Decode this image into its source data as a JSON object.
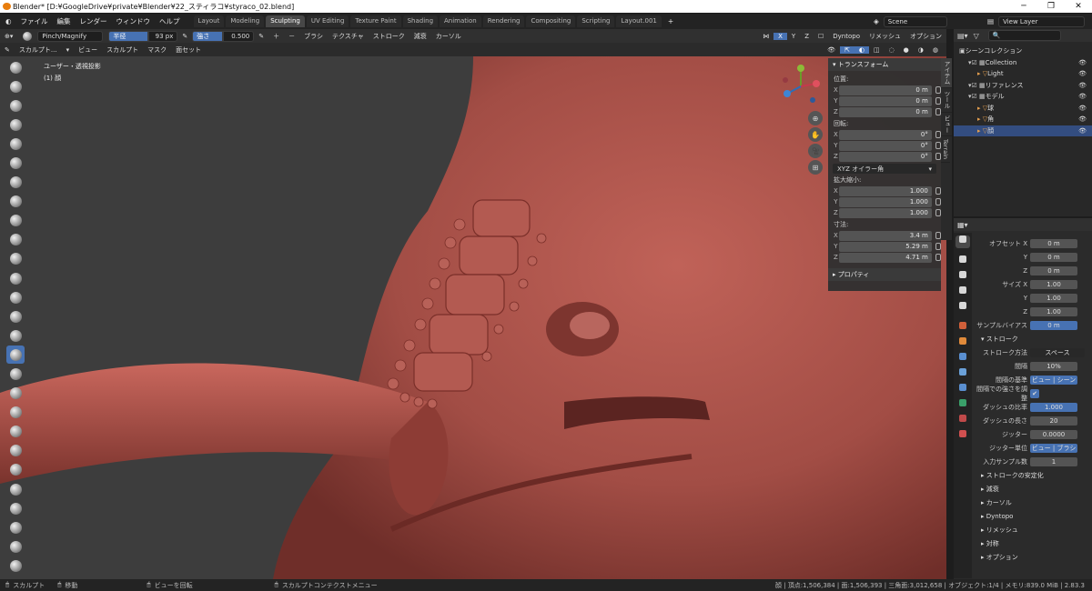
{
  "title": "Blender* [D:¥GoogleDrive¥private¥Blender¥22_スティラコ¥styraco_02.blend]",
  "menus": [
    "ファイル",
    "編集",
    "レンダー",
    "ウィンドウ",
    "ヘルプ"
  ],
  "workspaces": [
    "Layout",
    "Modeling",
    "Sculpting",
    "UV Editing",
    "Texture Paint",
    "Shading",
    "Animation",
    "Rendering",
    "Compositing",
    "Scripting",
    "Layout.001"
  ],
  "scene": "Scene",
  "view_layer": "View Layer",
  "hdr1": {
    "brush": "Pinch/Magnify",
    "radius_label": "半径",
    "radius_val": "93 px",
    "strength_label": "強さ",
    "strength_val": "0.500",
    "brush_menu": "ブラシ",
    "tex_menu": "テクスチャ",
    "stroke_menu": "ストローク",
    "falloff_menu": "減衰",
    "cursor_menu": "カーソル",
    "axes": [
      "X",
      "Y",
      "Z"
    ],
    "dyntopo": "Dyntopo",
    "remesh": "リメッシュ",
    "options": "オプション"
  },
  "hdr2": {
    "mode": "スカルプト...",
    "items": [
      "ビュー",
      "スカルプト",
      "マスク",
      "面セット"
    ]
  },
  "viewport": {
    "view_name": "ユーザー・透視投影",
    "object": "(1) 顔"
  },
  "npanel": {
    "transform_title": "トランスフォーム",
    "loc_label": "位置:",
    "loc": [
      [
        "X",
        "0 m"
      ],
      [
        "Y",
        "0 m"
      ],
      [
        "Z",
        "0 m"
      ]
    ],
    "rot_label": "回転:",
    "rot": [
      [
        "X",
        "0°"
      ],
      [
        "Y",
        "0°"
      ],
      [
        "Z",
        "0°"
      ]
    ],
    "rot_mode": "XYZ オイラー角",
    "scale_label": "拡大縮小:",
    "scale": [
      [
        "X",
        "1.000"
      ],
      [
        "Y",
        "1.000"
      ],
      [
        "Z",
        "1.000"
      ]
    ],
    "dim_label": "寸法:",
    "dim": [
      [
        "X",
        "3.4 m"
      ],
      [
        "Y",
        "5.29 m"
      ],
      [
        "Z",
        "4.71 m"
      ]
    ],
    "props_title": "プロパティ"
  },
  "vtabs": [
    "アイテム",
    "ツール",
    "ビュー",
    "Terrain"
  ],
  "outliner": [
    {
      "label": "シーンコレクション",
      "indent": 0,
      "sel": false
    },
    {
      "label": "Collection",
      "indent": 1,
      "sel": false
    },
    {
      "label": "Light",
      "indent": 2,
      "sel": false
    },
    {
      "label": "リファレンス",
      "indent": 1,
      "sel": false
    },
    {
      "label": "モデル",
      "indent": 1,
      "sel": false
    },
    {
      "label": "球",
      "indent": 2,
      "sel": false
    },
    {
      "label": "角",
      "indent": 2,
      "sel": false
    },
    {
      "label": "顔",
      "indent": 2,
      "sel": true
    }
  ],
  "props": [
    {
      "label": "オフセット X",
      "val": "0 m",
      "type": "val"
    },
    {
      "label": "Y",
      "val": "0 m",
      "type": "val"
    },
    {
      "label": "Z",
      "val": "0 m",
      "type": "val"
    },
    {
      "label": "サイズ X",
      "val": "1.00",
      "type": "val"
    },
    {
      "label": "Y",
      "val": "1.00",
      "type": "val"
    },
    {
      "label": "Z",
      "val": "1.00",
      "type": "val"
    },
    {
      "label": "サンプルバイアス",
      "val": "0 m",
      "type": "blue"
    },
    {
      "label": "▾ ストローク",
      "val": "",
      "type": "head"
    },
    {
      "label": "ストローク方法",
      "val": "スペース",
      "type": "select"
    },
    {
      "label": "間隔",
      "val": "10%",
      "type": "val"
    },
    {
      "label": "間隔の基準",
      "val": "ビュー | シーン",
      "type": "seg"
    },
    {
      "label": "間隔での強さを調整",
      "val": "✔",
      "type": "check"
    },
    {
      "label": "ダッシュの比率",
      "val": "1.000",
      "type": "blue"
    },
    {
      "label": "ダッシュの長さ",
      "val": "20",
      "type": "val"
    },
    {
      "label": "ジッター",
      "val": "0.0000",
      "type": "val"
    },
    {
      "label": "ジッター単位",
      "val": "ビュー | ブラシ",
      "type": "seg"
    },
    {
      "label": "入力サンプル数",
      "val": "1",
      "type": "val"
    },
    {
      "label": "▸ ストロークの安定化",
      "val": "",
      "type": "head"
    },
    {
      "label": "▸ 減衰",
      "val": "",
      "type": "head"
    },
    {
      "label": "▸ カーソル",
      "val": "",
      "type": "head"
    },
    {
      "label": "▸ Dyntopo",
      "val": "",
      "type": "head"
    },
    {
      "label": "▸ リメッシュ",
      "val": "",
      "type": "head"
    },
    {
      "label": "▸ 対称",
      "val": "",
      "type": "head"
    },
    {
      "label": "▸ オプション",
      "val": "",
      "type": "head"
    }
  ],
  "status": {
    "left1": "スカルプト",
    "left2": "移動",
    "mid1": "ビューを回転",
    "mid2": "スカルプトコンテクストメニュー",
    "right": "顔 | 頂点:1,506,384 | 面:1,506,393 | 三角面:3,012,658 | オブジェクト:1/4 | メモリ:839.0 MiB | 2.83.3"
  }
}
